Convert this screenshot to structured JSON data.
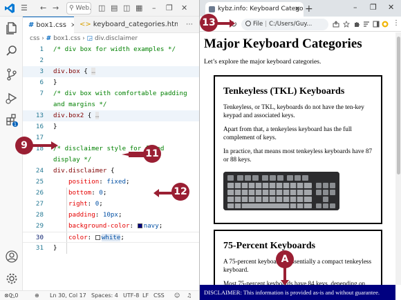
{
  "vscode": {
    "search_placeholder": "Web...",
    "tabs": [
      {
        "label": "box1.css",
        "active": true
      },
      {
        "label": "keyboard_categories.html",
        "active": false
      }
    ],
    "breadcrumb": [
      "css",
      "box1.css",
      "div.disclaimer"
    ],
    "lines": [
      {
        "n": "1",
        "text": "/* div box for width examples */"
      },
      {
        "n": "2",
        "text": ""
      },
      {
        "n": "3",
        "sel": "div.box",
        "fold": "…"
      },
      {
        "n": "6",
        "text": "}"
      },
      {
        "n": "7",
        "text": "/* div box with comfortable padding"
      },
      {
        "n": "",
        "text": "and margins */"
      },
      {
        "n": "13",
        "sel": "div.box2",
        "fold": "…"
      },
      {
        "n": "16",
        "text": "}"
      },
      {
        "n": "17",
        "text": ""
      },
      {
        "n": "18",
        "text": "/* disclaimer style for fixed"
      },
      {
        "n": "",
        "text": "display */"
      },
      {
        "n": "24",
        "sel": "div.disclaimer"
      },
      {
        "n": "25",
        "prop": "position",
        "val": "fixed"
      },
      {
        "n": "26",
        "prop": "bottom",
        "val": "0"
      },
      {
        "n": "27",
        "prop": "right",
        "val": "0"
      },
      {
        "n": "28",
        "prop": "padding",
        "val": "10px"
      },
      {
        "n": "29",
        "prop": "background-color",
        "val": "navy",
        "swatch": "#000080"
      },
      {
        "n": "30",
        "prop": "color",
        "val": "white",
        "swatch": "#ffffff"
      },
      {
        "n": "31",
        "text": "}"
      }
    ],
    "status": {
      "errors": "0",
      "warnings": "0",
      "position": "Ln 30, Col 17",
      "spaces": "Spaces: 4",
      "encoding": "UTF-8",
      "eol": "LF",
      "language": "CSS"
    }
  },
  "browser": {
    "tab_title": "kybz.info: Keyboard Categories",
    "address_scheme": "File",
    "address_path": "C:/Users/Guy...",
    "page": {
      "h1": "Major Keyboard Categories",
      "intro": "Let’s explore the major keyboard categories.",
      "sections": [
        {
          "title": "Tenkeyless (TKL) Keyboards",
          "paragraphs": [
            "Tenkeyless, or TKL, keyboards do not have the ten-key keypad and associated keys.",
            "Apart from that, a tenkeyless keyboard has the full complement of keys.",
            "In practice, that means most tenkeyless keyboards have 87 or 88 keys."
          ]
        },
        {
          "title": "75-Percent Keyboards",
          "paragraphs": [
            "A 75-percent keyboard is essentially a compact tenkeyless keyboard.",
            "Most 75-percent keyboards have 84 keys, depending on"
          ]
        }
      ],
      "disclaimer": "DISCLAIMER: This information is provided as-is and without guarantee."
    }
  },
  "callouts": [
    "9",
    "11",
    "12",
    "13",
    "A"
  ],
  "colors": {
    "callout": "#9a1f33",
    "navy": "#000080",
    "accent": "#005fb8"
  }
}
